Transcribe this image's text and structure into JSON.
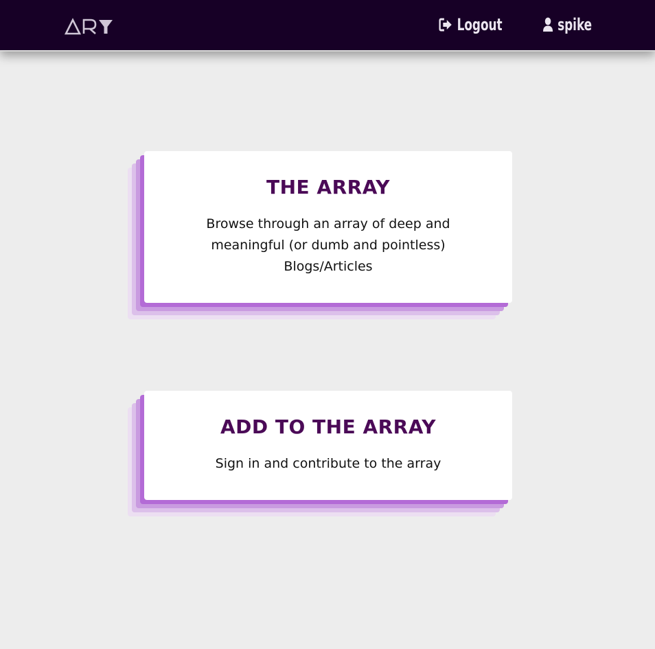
{
  "navbar": {
    "logo_text": "ARY",
    "logout_label": "Logout",
    "user_label": "spike"
  },
  "cards": [
    {
      "title": "THE ARRAY",
      "description": "Browse through an array of deep and meaningful (or dumb and pointless) Blogs/Articles"
    },
    {
      "title": "ADD TO THE ARRAY",
      "description": "Sign in and contribute to the array"
    }
  ],
  "colors": {
    "navbar_bg": "#170026",
    "page_bg": "#ededed",
    "title_color": "#4b0a57",
    "accent_shadow": "#a64fd0"
  }
}
